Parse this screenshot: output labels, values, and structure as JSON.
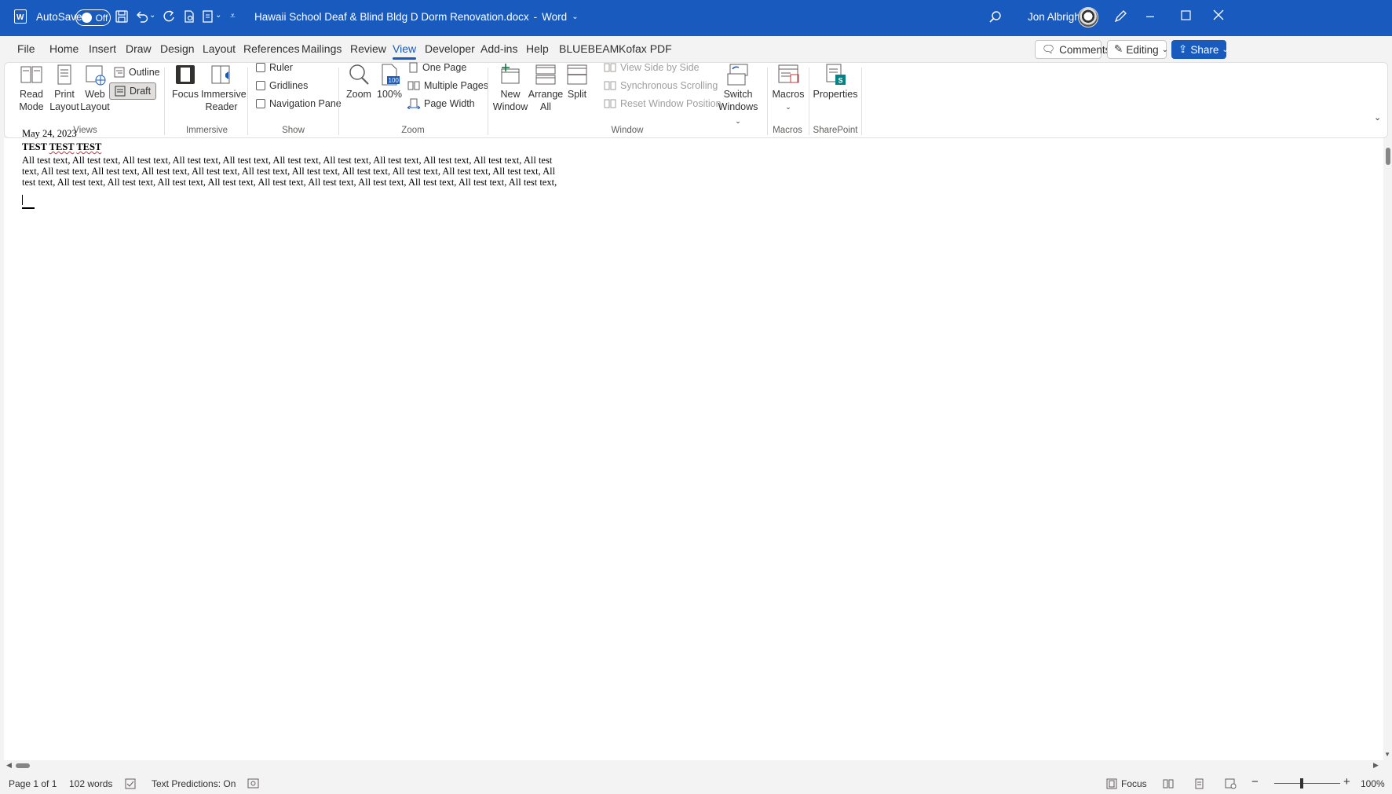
{
  "titlebar": {
    "autosave_label": "AutoSave",
    "autosave_state": "Off",
    "doc_title": "Hawaii School Deaf & Blind Bldg D Dorm Renovation.docx",
    "app_name": "Word",
    "separator": "-",
    "user_name": "Jon Albright"
  },
  "menu": {
    "tabs": [
      "File",
      "Home",
      "Insert",
      "Draw",
      "Design",
      "Layout",
      "References",
      "Mailings",
      "Review",
      "View",
      "Developer",
      "Add-ins",
      "Help",
      "BLUEBEAM",
      "Kofax PDF"
    ],
    "active_tab": "View",
    "comments_label": "Comments",
    "editing_label": "Editing",
    "share_label": "Share"
  },
  "ribbon": {
    "views": {
      "read_mode": "Read\nMode",
      "read_mode_1": "Read",
      "read_mode_2": "Mode",
      "print_layout_1": "Print",
      "print_layout_2": "Layout",
      "web_layout_1": "Web",
      "web_layout_2": "Layout",
      "outline": "Outline",
      "draft": "Draft",
      "group_label": "Views"
    },
    "immersive": {
      "focus": "Focus",
      "immersive_reader_1": "Immersive",
      "immersive_reader_2": "Reader",
      "group_label": "Immersive"
    },
    "show": {
      "ruler": "Ruler",
      "gridlines": "Gridlines",
      "navigation_pane": "Navigation Pane",
      "group_label": "Show"
    },
    "zoom": {
      "zoom": "Zoom",
      "hundred": "100%",
      "one_page": "One Page",
      "multiple_pages": "Multiple Pages",
      "page_width": "Page Width",
      "group_label": "Zoom"
    },
    "window": {
      "new_window_1": "New",
      "new_window_2": "Window",
      "arrange_all_1": "Arrange",
      "arrange_all_2": "All",
      "split": "Split",
      "view_side_by_side": "View Side by Side",
      "synchronous_scrolling": "Synchronous Scrolling",
      "reset_window_position": "Reset Window Position",
      "switch_windows_1": "Switch",
      "switch_windows_2": "Windows",
      "group_label": "Window"
    },
    "macros": {
      "macros": "Macros",
      "group_label": "Macros"
    },
    "sharepoint": {
      "properties": "Properties",
      "group_label": "SharePoint"
    }
  },
  "document": {
    "date": "May 24, 2023",
    "heading": "TEST TEST TEST",
    "heading_parts": [
      "TEST",
      "TEST",
      "TEST"
    ],
    "line1": "All test text, All test text, All test text, All test text, All test text, All test text, All test text, All test text, All test text, All test text, All test",
    "line2": "text, All test text, All test text, All test text, All test text, All test text, All test text, All test text, All test text, All test text, All test text, All",
    "line3": "test text, All test text, All test text, All test text, All test text, All test text, All test text, All test text, All test text, All test text, All test text,"
  },
  "statusbar": {
    "page": "Page 1 of 1",
    "words": "102 words",
    "text_predictions": "Text Predictions: On",
    "focus": "Focus",
    "zoom": "100%"
  },
  "colors": {
    "titlebar": "#185abd",
    "accent": "#185abd",
    "ribbon_bg": "#ffffff",
    "app_bg": "#f3f3f3"
  }
}
